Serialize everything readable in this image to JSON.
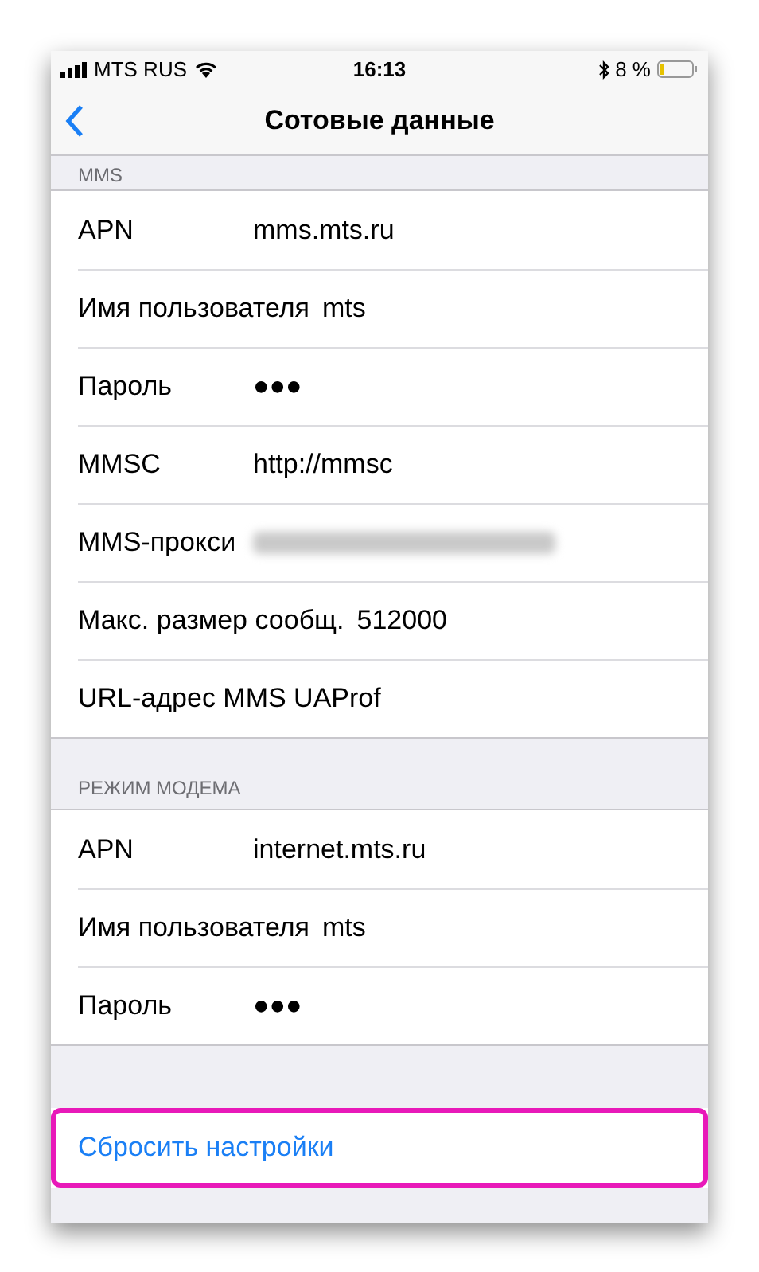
{
  "status_bar": {
    "carrier": "MTS RUS",
    "time": "16:13",
    "battery": "8 %"
  },
  "nav": {
    "title": "Сотовые данные"
  },
  "sections": [
    {
      "header": "MMS",
      "rows": [
        {
          "label": "APN",
          "value": "mms.mts.ru",
          "kind": "text"
        },
        {
          "label": "Имя пользователя",
          "value": "mts",
          "kind": "text"
        },
        {
          "label": "Пароль",
          "value": "●●●",
          "kind": "text"
        },
        {
          "label": "MMSC",
          "value": "http://mmsc",
          "kind": "text"
        },
        {
          "label": "MMS-прокси",
          "kind": "blurred"
        },
        {
          "label": "Макс. размер сообщ.",
          "value": "512000",
          "kind": "text"
        },
        {
          "label": "URL-адрес MMS UAProf",
          "kind": "empty"
        }
      ]
    },
    {
      "header": "РЕЖИМ МОДЕМА",
      "rows": [
        {
          "label": "APN",
          "value": "internet.mts.ru",
          "kind": "text"
        },
        {
          "label": "Имя пользователя",
          "value": "mts",
          "kind": "text"
        },
        {
          "label": "Пароль",
          "value": "●●●",
          "kind": "text"
        }
      ]
    }
  ],
  "reset": {
    "label": "Сбросить настройки",
    "highlighted": true
  }
}
